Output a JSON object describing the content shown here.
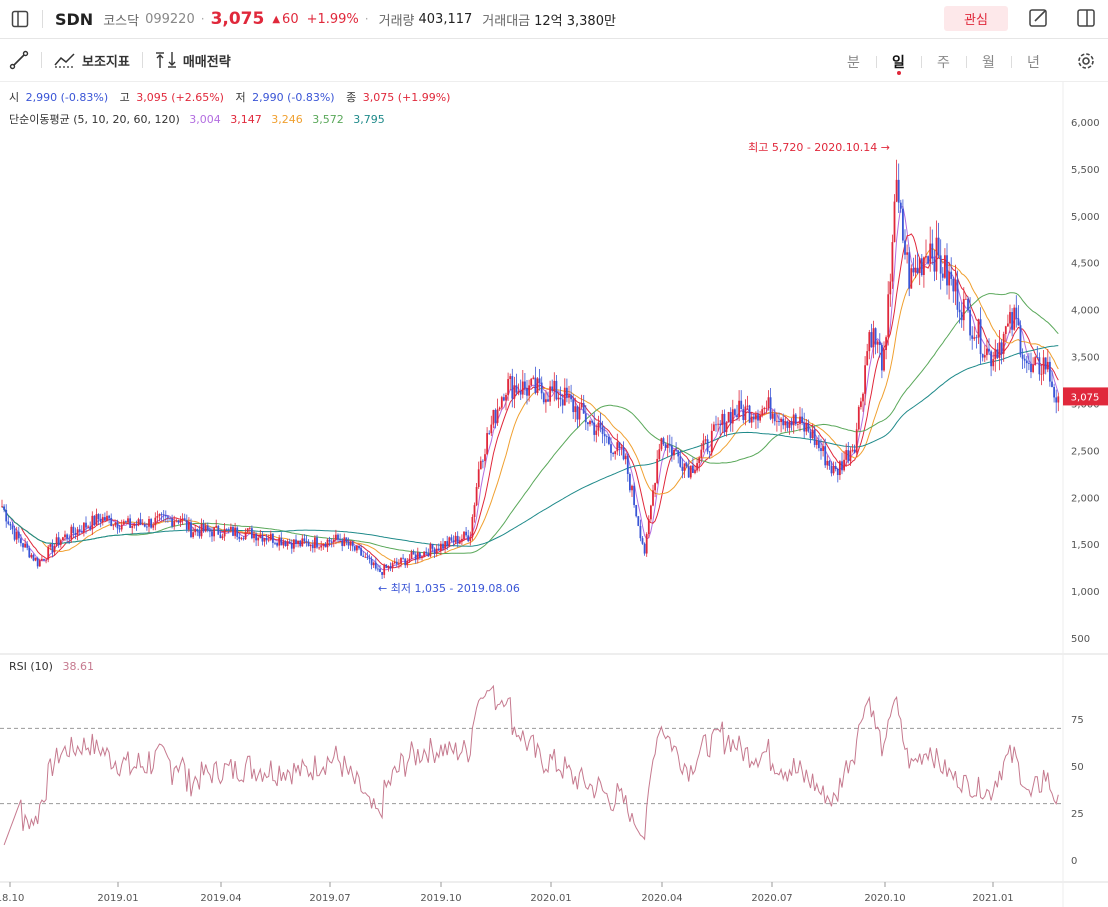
{
  "header": {
    "symbol": "SDN",
    "market": "코스닥",
    "code": "099220",
    "separator": "·",
    "price": "3,075",
    "change_arrow": "▲",
    "change": "60",
    "change_pct": "+1.99%",
    "volume_label": "거래량",
    "volume": "403,117",
    "amount_label": "거래대금",
    "amount": "12억 3,380만",
    "watch_button": "관심"
  },
  "toolbar": {
    "indicator_label": "보조지표",
    "strategy_label": "매매전략",
    "periods": [
      "분",
      "일",
      "주",
      "월",
      "년"
    ],
    "active_period": "일"
  },
  "ohlc": {
    "open_label": "시",
    "open": "2,990 (-0.83%)",
    "high_label": "고",
    "high": "3,095 (+2.65%)",
    "low_label": "저",
    "low": "2,990 (-0.83%)",
    "close_label": "종",
    "close": "3,075 (+1.99%)"
  },
  "ma_legend": {
    "label": "단순이동평균 (5, 10, 20, 60, 120)",
    "values": [
      "3,004",
      "3,147",
      "3,246",
      "3,572",
      "3,795"
    ],
    "colors": [
      "#b36ee0",
      "#e0283b",
      "#f0a030",
      "#5aa85a",
      "#1f8a8a"
    ]
  },
  "chart_data": [
    {
      "type": "line",
      "series_kind": "candlestick",
      "x": [
        "2018.10",
        "2019.01",
        "2019.04",
        "2019.07",
        "2019.10",
        "2020.01",
        "2020.04",
        "2020.07",
        "2020.10",
        "2021.01",
        "2021.03"
      ],
      "close": [
        1800,
        1650,
        1600,
        1450,
        1650,
        3100,
        2450,
        2850,
        4700,
        3600,
        3075
      ],
      "ylim": [
        500,
        6000
      ],
      "y_ticks": [
        "6,000",
        "5,500",
        "5,000",
        "4,500",
        "4,000",
        "3,500",
        "3,000",
        "2,500",
        "2,000",
        "1,500",
        "1,000",
        "500"
      ],
      "x_ticks": [
        "18.10",
        "2019.01",
        "2019.04",
        "2019.07",
        "2019.10",
        "2020.01",
        "2020.04",
        "2020.07",
        "2020.10",
        "2021.01"
      ],
      "last_price_label": "3,075",
      "annotations": {
        "high": "최고 5,720 - 2020.10.14 →",
        "low": "← 최저 1,035 - 2019.08.06"
      },
      "up_color": "#e0283b",
      "down_color": "#3a55d6"
    },
    {
      "type": "line",
      "series_name": "RSI (10)",
      "value_label": "38.61",
      "ylim": [
        0,
        100
      ],
      "y_ticks": [
        "75",
        "50",
        "25",
        "0"
      ],
      "levels": [
        30,
        70
      ],
      "color": "#c67a8f"
    }
  ]
}
